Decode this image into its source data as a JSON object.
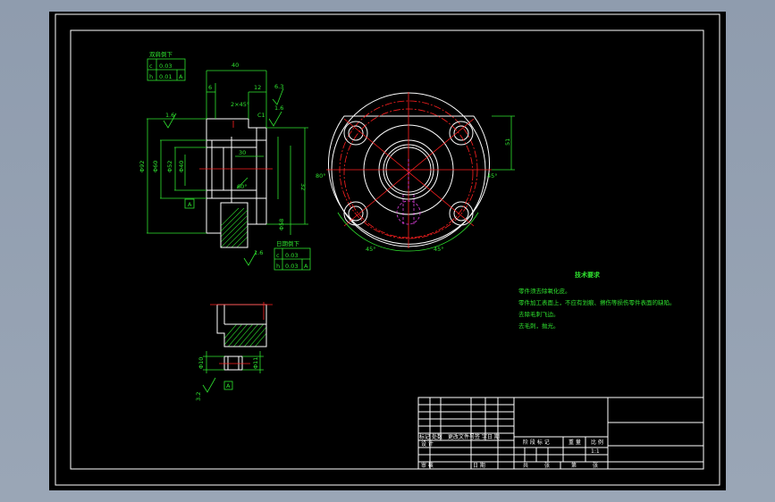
{
  "colors": {
    "background": "#9aa6b6",
    "sheet": "#000000",
    "line": "#ffffff",
    "dimension": "#2fe42f",
    "centerline": "#ff2020",
    "hidden": "#e040e0"
  },
  "tolerance_top": {
    "title": "双肩倒下",
    "rows": [
      {
        "symbol": "c",
        "value": "0.03"
      },
      {
        "symbol": "h",
        "value": "0.01",
        "datum": "A"
      }
    ]
  },
  "tolerance_bottom": {
    "title": "日期倒下",
    "rows": [
      {
        "symbol": "c",
        "value": "0.03"
      },
      {
        "symbol": "h",
        "value": "0.03",
        "datum": "A"
      }
    ]
  },
  "dims": {
    "d40": "40",
    "d12": "12",
    "d6": "6",
    "d63": "6.3",
    "chamfer": "2×45°",
    "c1": "C1",
    "r16a": "1.6",
    "r16b": "1.6",
    "r16c": "1.6",
    "phi92": "Φ92",
    "phi60": "Φ60",
    "phi52": "Φ52",
    "phi40": "Φ40",
    "d30": "30",
    "d32": "32",
    "angle60": "60°",
    "phi58": "Φ58",
    "deg80": "80°",
    "deg45a": "45°",
    "deg45b": "45°",
    "deg45c": "45°",
    "d51": "51",
    "phi10": "Φ10",
    "phi11": "Φ11",
    "d32b": "3.2",
    "datum_a": "A",
    "datum_a2": "A"
  },
  "tech": {
    "title": "技术要求",
    "lines": [
      "零件须去除氧化皮。",
      "零件加工表面上，不应有划痕、擦伤等损伤零件表面的缺陷。",
      "去除毛刺飞边。",
      "去毛刺，抛光。"
    ]
  },
  "titleblock": {
    "left_row_a": [
      "标记",
      "处数",
      "更改文件号",
      "签 字",
      "日 期"
    ],
    "left_row_b": [
      "设 计"
    ],
    "left_row_c": [
      "审 核"
    ],
    "left_row_d": [
      "日 期"
    ],
    "mid_labels": [
      "阶 段 标 记",
      "重 量",
      "比 例"
    ],
    "scale": "1:1",
    "bottom_labels": [
      "共",
      "张",
      "第",
      "张"
    ]
  }
}
